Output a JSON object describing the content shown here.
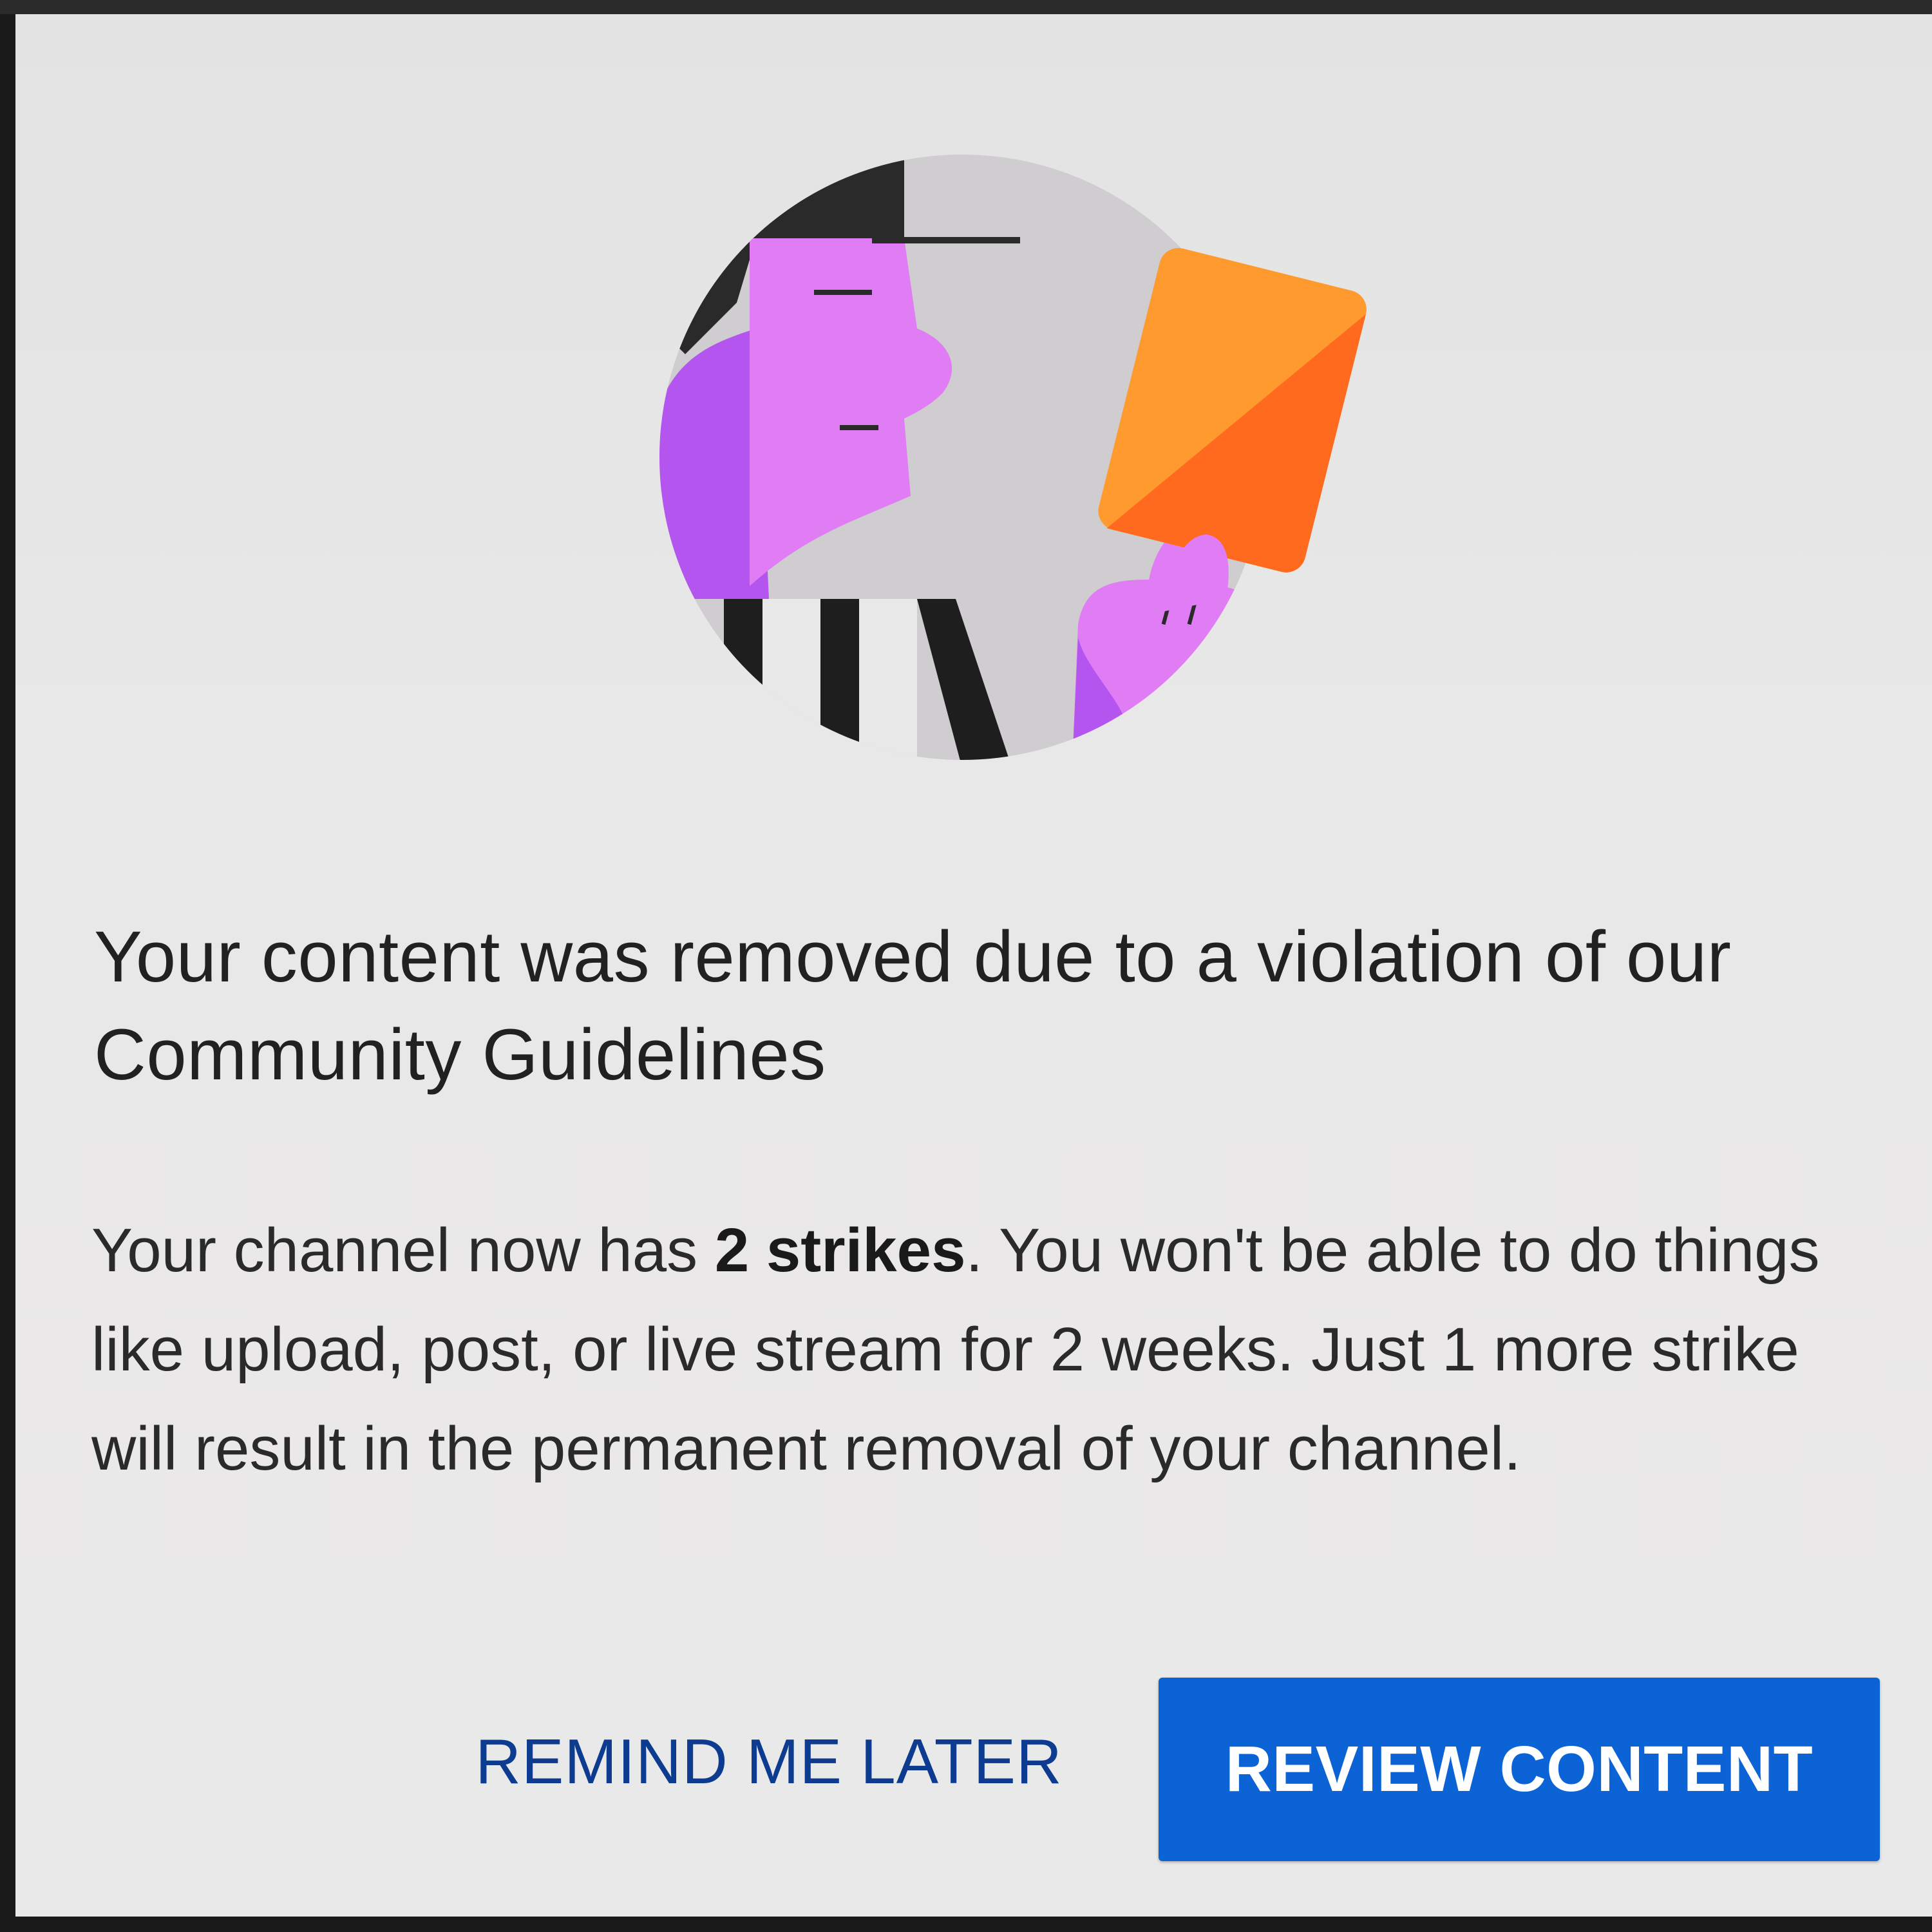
{
  "dialog": {
    "title": "Your content was removed due to a violation of our Community Guidelines",
    "body_prefix": "Your channel now has ",
    "body_strong": "2 strikes",
    "body_suffix": ". You won't be able to do things like upload, post, or live stream for 2 weeks. Just 1 more strike will result in the permanent removal of your channel.",
    "illustration_icon": "referee-yellow-card-illustration"
  },
  "actions": {
    "remind_label": "REMIND ME LATER",
    "review_label": "REVIEW CONTENT"
  },
  "colors": {
    "primary_button": "#0b63d6",
    "secondary_text": "#0c3b8f",
    "card_orange": "#ff9a2e",
    "card_dark_orange": "#ff6a1f",
    "skin_purple": "#e07df4",
    "shadow_purple": "#b455f0"
  }
}
